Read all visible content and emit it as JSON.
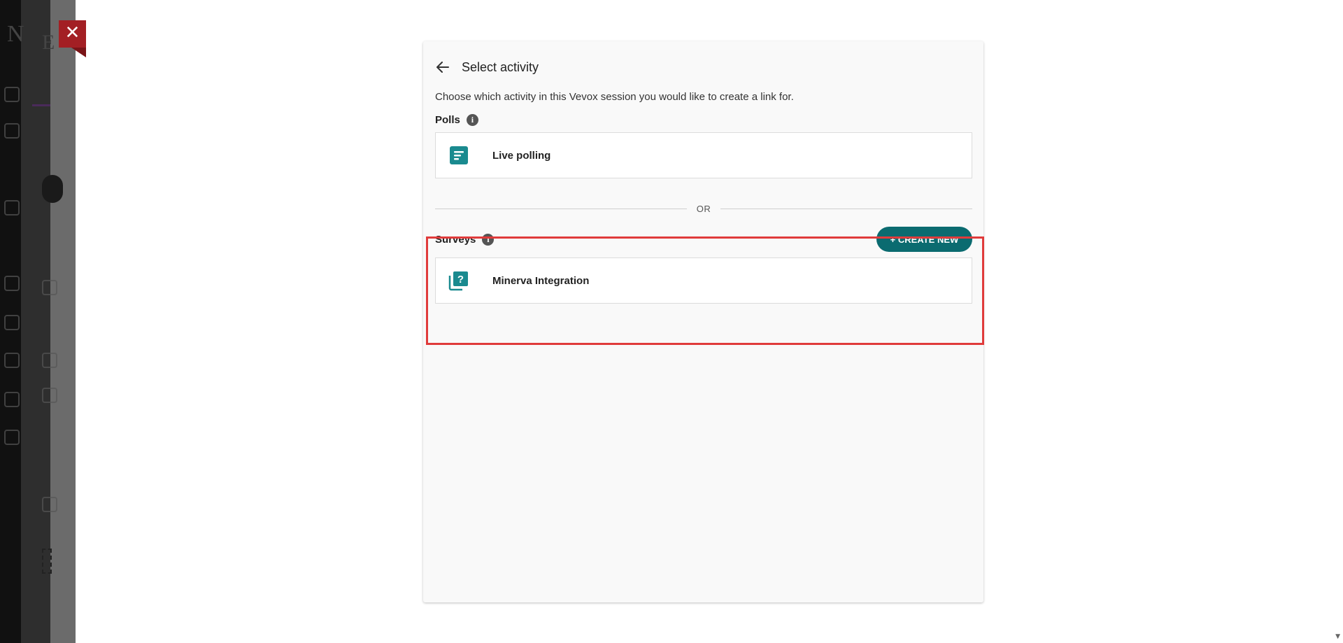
{
  "dialog": {
    "close_icon": "✕",
    "back_icon": "arrow-left-icon",
    "title": "Select activity",
    "description": "Choose which activity in this Vevox session you would like to create a link for.",
    "polls": {
      "label": "Polls",
      "info_icon": "i",
      "items": [
        {
          "label": "Live polling",
          "icon": "poll-list-icon"
        }
      ]
    },
    "divider_text": "OR",
    "surveys": {
      "label": "Surveys",
      "info_icon": "i",
      "create_button": "+ CREATE NEW",
      "items": [
        {
          "label": "Minerva Integration",
          "icon": "survey-question-icon"
        }
      ]
    }
  },
  "colors": {
    "accent_teal": "#0b6b70",
    "icon_teal": "#1a8a8f",
    "close_red": "#a31f24",
    "highlight_red": "#e03b3b"
  },
  "scroll_icon": "▼"
}
